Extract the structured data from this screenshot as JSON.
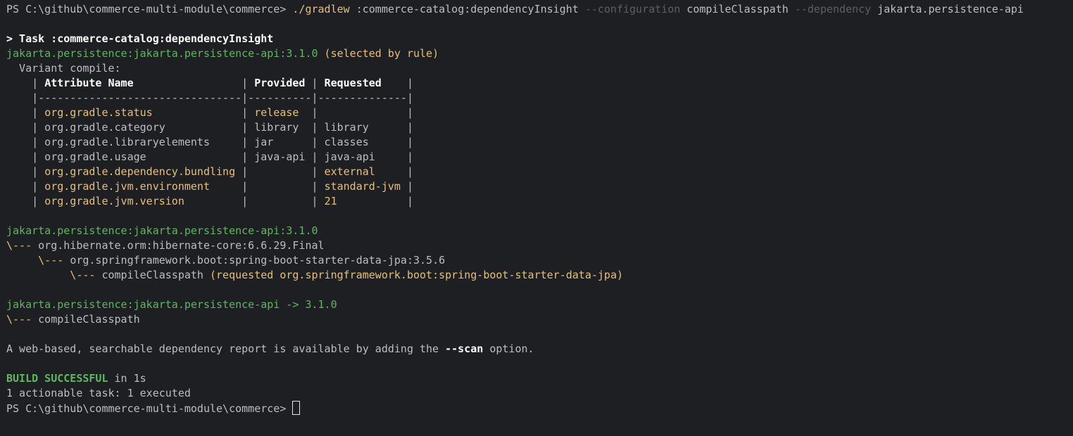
{
  "colors": {
    "background": "#1e1f22",
    "default": "#bcbec4",
    "yellow": "#e5c07b",
    "green": "#5fb760",
    "bold_white": "#ffffff",
    "dim": "#5c5f66"
  },
  "lines": [
    [
      [
        "PS C:\\github\\commerce-multi-module\\commerce> ",
        "default"
      ],
      [
        "./gradlew",
        "yellow"
      ],
      [
        " :commerce-catalog:dependencyInsight ",
        "default"
      ],
      [
        "--configuration",
        "dim"
      ],
      [
        " compileClasspath ",
        "default"
      ],
      [
        "--dependency",
        "dim"
      ],
      [
        " jakarta.persistence-api",
        "default"
      ]
    ],
    [],
    [
      [
        "> Task :commerce-catalog:dependencyInsight",
        "bold"
      ]
    ],
    [
      [
        "jakarta.persistence:jakarta.persistence-api:3.1.0",
        "green"
      ],
      [
        " (selected by rule)",
        "yellow"
      ]
    ],
    [
      [
        "  Variant compile:",
        "default"
      ]
    ],
    [
      [
        "    | ",
        "default"
      ],
      [
        "Attribute Name",
        "bold"
      ],
      [
        "                 | ",
        "default"
      ],
      [
        "Provided",
        "bold"
      ],
      [
        " | ",
        "default"
      ],
      [
        "Requested",
        "bold"
      ],
      [
        "    |",
        "default"
      ]
    ],
    [
      [
        "    |--------------------------------|----------|--------------|",
        "default"
      ]
    ],
    [
      [
        "    | ",
        "default"
      ],
      [
        "org.gradle.status",
        "yellow"
      ],
      [
        "              | ",
        "default"
      ],
      [
        "release",
        "yellow"
      ],
      [
        "  |              |",
        "default"
      ]
    ],
    [
      [
        "    | org.gradle.category            | library  | library      |",
        "default"
      ]
    ],
    [
      [
        "    | org.gradle.libraryelements     | jar      | classes      |",
        "default"
      ]
    ],
    [
      [
        "    | org.gradle.usage               | java-api | java-api     |",
        "default"
      ]
    ],
    [
      [
        "    | ",
        "default"
      ],
      [
        "org.gradle.dependency.bundling",
        "yellow"
      ],
      [
        " |          | ",
        "default"
      ],
      [
        "external",
        "yellow"
      ],
      [
        "     |",
        "default"
      ]
    ],
    [
      [
        "    | ",
        "default"
      ],
      [
        "org.gradle.jvm.environment",
        "yellow"
      ],
      [
        "     |          | ",
        "default"
      ],
      [
        "standard-jvm",
        "yellow"
      ],
      [
        " |",
        "default"
      ]
    ],
    [
      [
        "    | ",
        "default"
      ],
      [
        "org.gradle.jvm.version",
        "yellow"
      ],
      [
        "         |          | ",
        "default"
      ],
      [
        "21",
        "yellow"
      ],
      [
        "           |",
        "default"
      ]
    ],
    [],
    [
      [
        "jakarta.persistence:jakarta.persistence-api:3.1.0",
        "green"
      ]
    ],
    [
      [
        "\\--- ",
        "yellow"
      ],
      [
        "org.hibernate.orm:hibernate-core:6.6.29.Final",
        "default"
      ]
    ],
    [
      [
        "     \\--- ",
        "yellow"
      ],
      [
        "org.springframework.boot:spring-boot-starter-data-jpa:3.5.6",
        "default"
      ]
    ],
    [
      [
        "          \\--- ",
        "yellow"
      ],
      [
        "compileClasspath",
        "default"
      ],
      [
        " (requested org.springframework.boot:spring-boot-starter-data-jpa)",
        "yellow"
      ]
    ],
    [],
    [
      [
        "jakarta.persistence:jakarta.persistence-api -> 3.1.0",
        "green"
      ]
    ],
    [
      [
        "\\--- ",
        "yellow"
      ],
      [
        "compileClasspath",
        "default"
      ]
    ],
    [],
    [
      [
        "A web-based, searchable dependency report is available by adding the ",
        "default"
      ],
      [
        "--scan",
        "bold"
      ],
      [
        " option.",
        "default"
      ]
    ],
    [],
    [
      [
        "BUILD SUCCESSFUL",
        "bgreen"
      ],
      [
        " in 1s",
        "default"
      ]
    ],
    [
      [
        "1 actionable task: 1 executed",
        "default"
      ]
    ],
    [
      [
        "PS C:\\github\\commerce-multi-module\\commerce> ",
        "default"
      ]
    ]
  ]
}
